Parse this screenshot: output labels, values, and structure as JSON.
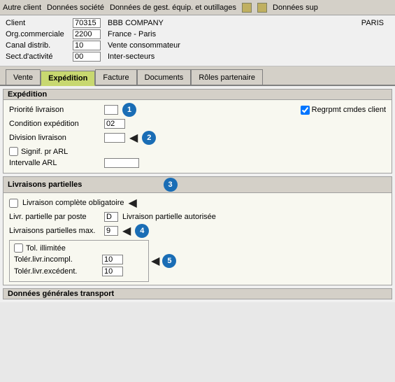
{
  "menubar": {
    "items": [
      {
        "label": "Autre client"
      },
      {
        "label": "Données société"
      },
      {
        "label": "Données de gest. équip. et outillages"
      },
      {
        "label": "Données sup"
      }
    ],
    "icons": [
      "doc-icon",
      "doc2-icon"
    ]
  },
  "client": {
    "rows": [
      {
        "label": "Client",
        "value": "70315",
        "text": "BBB COMPANY",
        "extra": "PARIS"
      },
      {
        "label": "Org.commerciale",
        "value": "2200",
        "text": "France - Paris"
      },
      {
        "label": "Canal distrib.",
        "value": "10",
        "text": "Vente consommateur"
      },
      {
        "label": "Sect.d'activité",
        "value": "00",
        "text": "Inter-secteurs"
      }
    ]
  },
  "tabs": [
    {
      "label": "Vente",
      "active": false
    },
    {
      "label": "Expédition",
      "active": true
    },
    {
      "label": "Facture",
      "active": false
    },
    {
      "label": "Documents",
      "active": false
    },
    {
      "label": "Rôles partenaire",
      "active": false
    }
  ],
  "expedition": {
    "section_title": "Expédition",
    "fields": {
      "priorite_label": "Priorité livraison",
      "priorite_value": "",
      "condition_label": "Condition expédition",
      "condition_value": "02",
      "division_label": "Division livraison",
      "division_value": "",
      "signif_label": "Signif. pr ARL",
      "intervalle_label": "Intervalle ARL",
      "intervalle_value": "",
      "regrpmt_label": "Regrpmt cmdes client",
      "regrpmt_checked": true
    },
    "annotations": {
      "1": "1",
      "2": "2"
    }
  },
  "livraisons": {
    "section_title": "Livraisons partielles",
    "fields": {
      "complete_label": "Livraison complète obligatoire",
      "complete_checked": false,
      "partielle_par_label": "Livr. partielle par poste",
      "partielle_par_value": "D",
      "partielle_autorisee": "Livraison partielle autorisée",
      "max_label": "Livraisons partielles max.",
      "max_value": "9",
      "tol_illimitee_label": "Tol. illimitée",
      "tol_illimitee_checked": false,
      "tolerer_incompl_label": "Tolér.livr.incompl.",
      "tolerer_incompl_value": "10",
      "tolerer_exced_label": "Tolér.livr.excédent.",
      "tolerer_exced_value": "10"
    },
    "annotations": {
      "3": "3",
      "4": "4",
      "5": "5"
    }
  },
  "transport": {
    "section_title": "Données générales transport"
  }
}
